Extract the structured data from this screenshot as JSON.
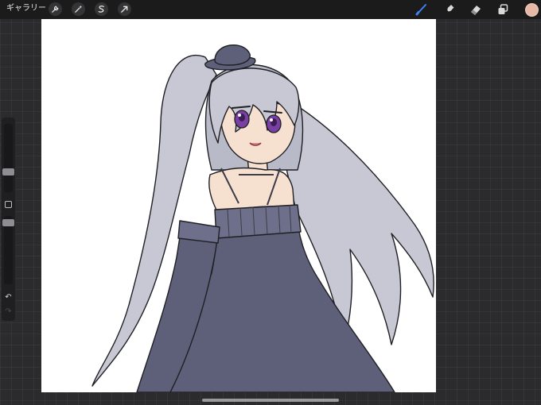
{
  "topbar": {
    "gallery_label": "ギャラリー",
    "left_tools": [
      "wrench-icon",
      "magic-wand-icon",
      "selection-icon",
      "transform-arrow-icon"
    ],
    "right_tools": [
      "brush-icon",
      "smudge-icon",
      "eraser-icon",
      "layers-icon"
    ],
    "active_tool": "brush-icon"
  },
  "colors": {
    "accent": "#3f82f4",
    "current_color": "#e6b8a5",
    "canvas_bg": "#ffffff",
    "hair": "#c7c8d4",
    "dress": "#5e5f79",
    "skin": "#f6e0cf",
    "eyes": "#7a3fa2"
  },
  "sidebar": {
    "brush_size": 0.45,
    "opacity": 0.35,
    "undo_icon": "↶",
    "redo_icon": "↷"
  }
}
